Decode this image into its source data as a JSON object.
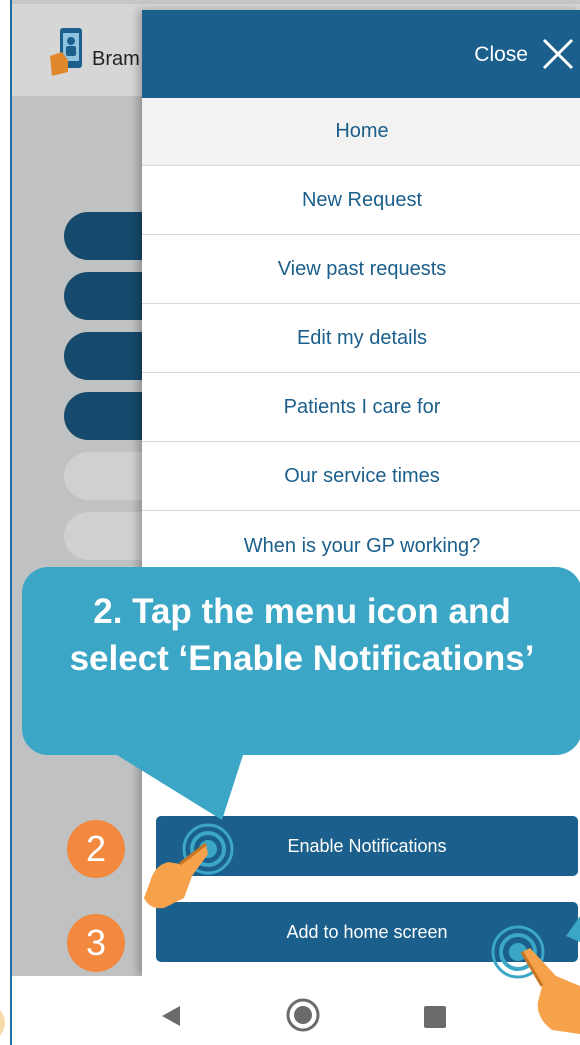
{
  "app": {
    "name": "Bram"
  },
  "menu": {
    "close_label": "Close",
    "items": [
      {
        "label": "Home",
        "active": true
      },
      {
        "label": "New Request"
      },
      {
        "label": "View past requests"
      },
      {
        "label": "Edit my details"
      },
      {
        "label": "Patients I care for"
      },
      {
        "label": "Our service times"
      },
      {
        "label": "When is your GP working?"
      }
    ],
    "enable_notifications_label": "Enable Notifications",
    "add_home_screen_label": "Add to home screen"
  },
  "callout": {
    "text": "2. Tap the menu icon and select ‘Enable Notifications’"
  },
  "steps": {
    "badge_2": "2",
    "badge_3": "3"
  },
  "colors": {
    "brand_blue": "#1b5f8c",
    "callout_teal": "#3ba6c6",
    "step_orange": "#f2893e",
    "hand_orange": "#f5a24a"
  },
  "nav": {
    "icons": [
      "back-icon",
      "home-icon",
      "recent-apps-icon"
    ]
  }
}
